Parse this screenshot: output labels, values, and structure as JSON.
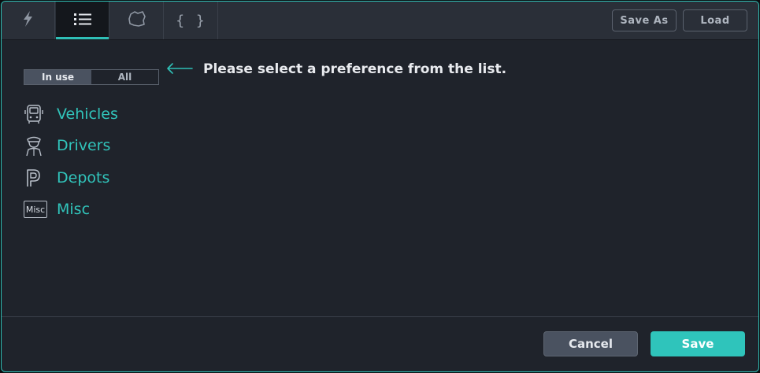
{
  "tabs": [
    {
      "name": "lightning",
      "icon": "lightning-icon"
    },
    {
      "name": "list",
      "icon": "list-icon",
      "active": true
    },
    {
      "name": "map",
      "icon": "map-region-icon"
    },
    {
      "name": "code",
      "icon": "braces-icon",
      "label": "{ }"
    }
  ],
  "toolbar": {
    "save_as_label": "Save As",
    "load_label": "Load"
  },
  "filter": {
    "in_use_label": "In use",
    "all_label": "All",
    "selected": "In use"
  },
  "hint": {
    "text": "Please select a preference from the list.",
    "icon": "arrow-left-icon"
  },
  "categories": [
    {
      "label": "Vehicles",
      "icon": "vehicle-icon"
    },
    {
      "label": "Drivers",
      "icon": "driver-icon"
    },
    {
      "label": "Depots",
      "icon": "parking-icon"
    },
    {
      "label": "Misc",
      "icon": "misc-icon",
      "icon_text": "Misc"
    }
  ],
  "footer": {
    "cancel_label": "Cancel",
    "save_label": "Save"
  },
  "colors": {
    "accent": "#2fbfb6",
    "background": "#1f232b",
    "topbar": "#2a2f38"
  }
}
